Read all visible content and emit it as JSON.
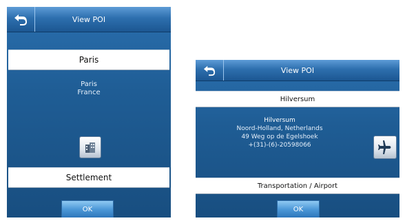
{
  "screens": [
    {
      "title": "View POI",
      "poi_name": "Paris",
      "details": [
        "Paris",
        "France"
      ],
      "category": "Settlement",
      "category_icon": "buildings-icon",
      "ok_label": "OK"
    },
    {
      "title": "View POI",
      "poi_name": "Hilversum",
      "details": [
        "Hilversum",
        "Noord-Holland, Netherlands",
        "49 Weg op de Egelshoek",
        "+(31)-(6)-20598066"
      ],
      "category": "Transportation / Airport",
      "category_icon": "airplane-icon",
      "ok_label": "OK"
    }
  ]
}
